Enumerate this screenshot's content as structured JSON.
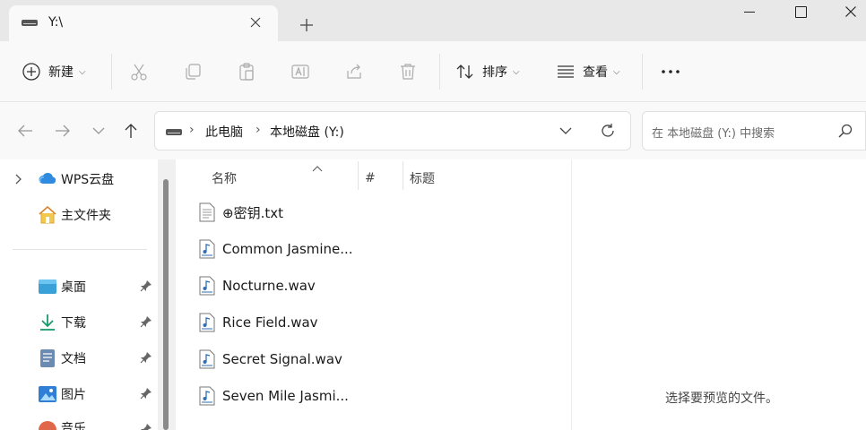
{
  "window": {
    "tab_title": "Y:\\",
    "tab_close_icon": "close-icon",
    "new_tab_icon": "plus-icon"
  },
  "toolbar": {
    "new_label": "新建",
    "sort_label": "排序",
    "view_label": "查看",
    "more_icon": "more-icon",
    "icons": [
      "cut-icon",
      "copy-icon",
      "paste-icon",
      "rename-icon",
      "share-icon",
      "delete-icon"
    ]
  },
  "address": {
    "crumbs": [
      "此电脑",
      "本地磁盘 (Y:)"
    ]
  },
  "search": {
    "placeholder": "在 本地磁盘 (Y:) 中搜索"
  },
  "nav": {
    "top": [
      {
        "label": "WPS云盘",
        "icon": "cloud-icon",
        "expandable": true
      },
      {
        "label": "主文件夹",
        "icon": "home-icon",
        "expandable": false
      }
    ],
    "quick_access": [
      {
        "label": "桌面",
        "icon": "desktop-icon",
        "pinned": true
      },
      {
        "label": "下载",
        "icon": "download-icon",
        "pinned": true
      },
      {
        "label": "文档",
        "icon": "document-icon",
        "pinned": true
      },
      {
        "label": "图片",
        "icon": "picture-icon",
        "pinned": true
      },
      {
        "label": "音乐",
        "icon": "music-icon",
        "pinned": true
      }
    ]
  },
  "files": {
    "columns": [
      "名称",
      "#",
      "标题"
    ],
    "rows": [
      {
        "name": "⊕密钥.txt",
        "icon": "text-file-icon"
      },
      {
        "name": "Common Jasmine...",
        "icon": "audio-file-icon"
      },
      {
        "name": "Nocturne.wav",
        "icon": "audio-file-icon"
      },
      {
        "name": "Rice Field.wav",
        "icon": "audio-file-icon"
      },
      {
        "name": "Secret Signal.wav",
        "icon": "audio-file-icon"
      },
      {
        "name": "Seven Mile Jasmi...",
        "icon": "audio-file-icon"
      }
    ]
  },
  "preview": {
    "message": "选择要预览的文件。"
  },
  "colors": {
    "accent": "#1e6fd9",
    "folder_yellow": "#f2c94c",
    "cloud_blue": "#2f8be0"
  }
}
